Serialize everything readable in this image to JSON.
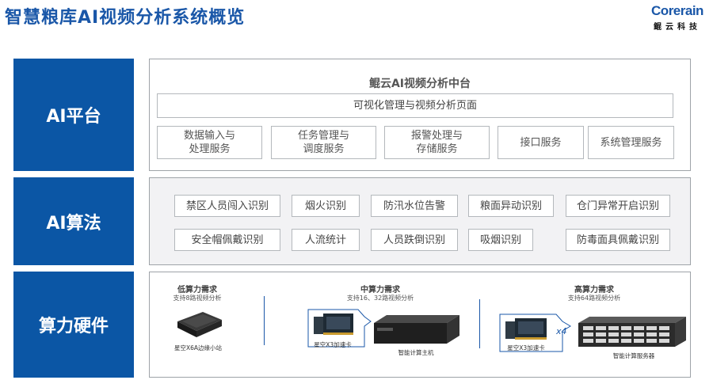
{
  "title": "智慧粮库AI视频分析系统概览",
  "logo": {
    "brand": "Corerain",
    "brand_cn": "鲲云科技"
  },
  "rows": {
    "platform": "AI平台",
    "algorithm": "AI算法",
    "hardware": "算力硬件"
  },
  "platform": {
    "center_title": "鲲云AI视频分析中台",
    "top_bar": "可视化管理与视频分析页面",
    "modules": [
      "数据输入与\n处理服务",
      "任务管理与\n调度服务",
      "报警处理与\n存储服务",
      "接口服务",
      "系统管理服务"
    ]
  },
  "algorithms": {
    "row1": [
      "禁区人员闯入识别",
      "烟火识别",
      "防汛水位告警",
      "粮面异动识别",
      "仓门异常开启识别"
    ],
    "row2": [
      "安全帽佩戴识别",
      "人流统计",
      "人员跌倒识别",
      "吸烟识别",
      "防毒面具佩戴识别"
    ]
  },
  "hardware": {
    "low": {
      "head": "低算力需求",
      "sub": "支持8路视频分析",
      "caption": "星空X6A边缘小站"
    },
    "mid": {
      "head": "中算力需求",
      "sub": "支持16、32路视频分析",
      "card_caption": "星空X3加速卡",
      "caption": "智能计算主机"
    },
    "high": {
      "head": "高算力需求",
      "sub": "支持64路视频分析",
      "card_caption": "星空X3加速卡",
      "multiplier": "x4",
      "caption": "智能计算服务器"
    }
  },
  "colors": {
    "primary": "#0b56a5",
    "title": "#1a57a8",
    "panel_bg": "#f2f2f4"
  }
}
